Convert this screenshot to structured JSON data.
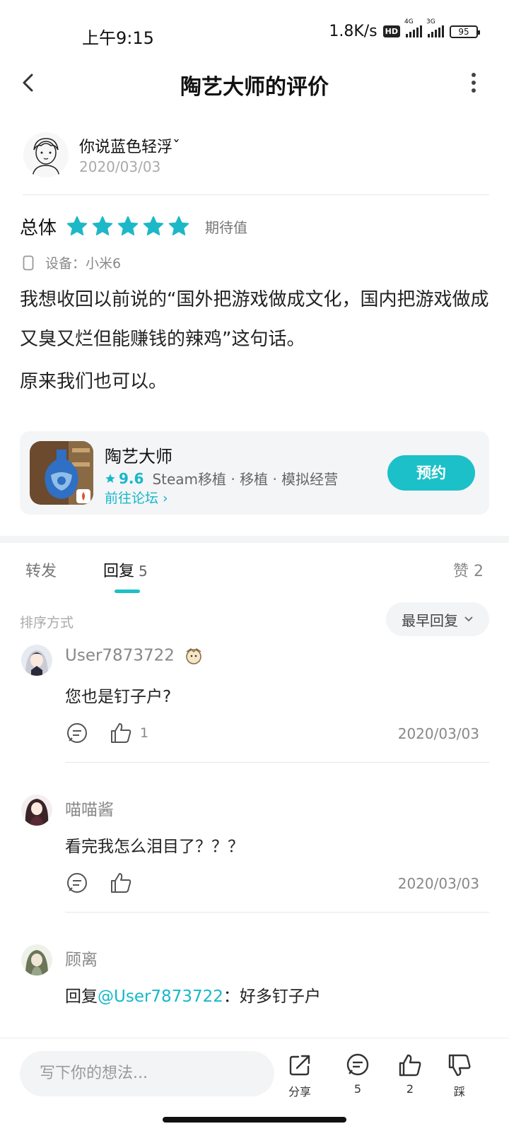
{
  "status_bar": {
    "time": "上午9:15",
    "speed": "1.8K/s",
    "hd": "HD",
    "net1": "4G",
    "net2": "3G",
    "battery": "95"
  },
  "header": {
    "title": "陶艺大师的评价",
    "back_icon": "chevron-left-icon",
    "more_icon": "more-vertical-icon"
  },
  "author": {
    "name": "你说蓝色轻浮ˇ",
    "date": "2020/03/03"
  },
  "rating": {
    "label": "总体",
    "stars": 5,
    "tag": "期待值"
  },
  "device": {
    "text": "设备：小米6"
  },
  "review": {
    "paragraph1": "我想收回以前说的“国外把游戏做成文化，国内把游戏做成又臭又烂但能赚钱的辣鸡”这句话。",
    "paragraph2": "原来我们也可以。"
  },
  "game_card": {
    "title": "陶艺大师",
    "score": "9.6",
    "tags": "Steam移植 · 移植 · 模拟经营",
    "forum_link": "前往论坛 ›",
    "reserve_button": "预约"
  },
  "tabs": {
    "repost": "转发",
    "reply": "回复",
    "reply_count": "5",
    "like": "赞 2"
  },
  "sort": {
    "label": "排序方式",
    "selected": "最早回复"
  },
  "comments": [
    {
      "name": "User7873722",
      "text": "您也是钉子户?",
      "likes": "1",
      "date": "2020/03/03"
    },
    {
      "name": "喵喵酱",
      "text": "看完我怎么泪目了？？？",
      "likes": "",
      "date": "2020/03/03"
    },
    {
      "name": "顾离",
      "reply_prefix": "回复",
      "mention": "@User7873722",
      "text": "：好多钉子户"
    }
  ],
  "bottom_bar": {
    "input_placeholder": "写下你的想法...",
    "share_label": "分享",
    "comment_count": "5",
    "like_count": "2",
    "dislike_label": "踩"
  },
  "colors": {
    "accent": "#1cc0c8",
    "star": "#1cb8c8"
  }
}
